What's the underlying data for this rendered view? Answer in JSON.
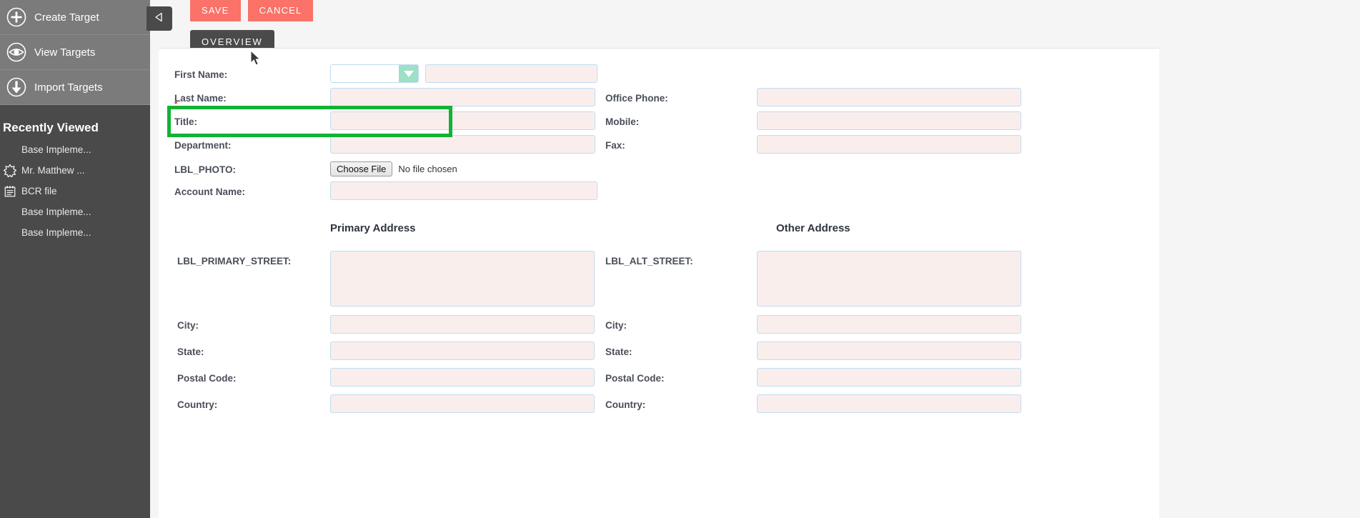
{
  "sidebar": {
    "nav_items": [
      {
        "label": "Create Target",
        "icon": "plus-circle-icon"
      },
      {
        "label": "View Targets",
        "icon": "eye-icon"
      },
      {
        "label": "Import Targets",
        "icon": "download-arrow-icon"
      }
    ],
    "recently_viewed_title": "Recently Viewed",
    "recent_items": [
      {
        "label": "Base Impleme...",
        "icon": "none"
      },
      {
        "label": "Mr. Matthew ...",
        "icon": "star-burst-icon"
      },
      {
        "label": "BCR file",
        "icon": "document-icon"
      },
      {
        "label": "Base Impleme...",
        "icon": "none"
      },
      {
        "label": "Base Impleme...",
        "icon": "none"
      }
    ],
    "collapse_icon": "collapse-left-triangle-icon"
  },
  "actions": {
    "save_label": "SAVE",
    "cancel_label": "CANCEL",
    "button_color": "#fa7268"
  },
  "tabs": [
    {
      "label": "OVERVIEW",
      "active": true
    }
  ],
  "form": {
    "left_column": {
      "first_name_label": "First Name:",
      "salutation_value": "",
      "first_name_value": "",
      "last_name_label": "Last Name:",
      "last_name_value": "",
      "last_name_required": true,
      "title_label": "Title:",
      "title_value": "",
      "department_label": "Department:",
      "department_value": "",
      "photo_label": "LBL_PHOTO:",
      "choose_file_label": "Choose File",
      "no_file_text": "No file chosen",
      "account_name_label": "Account Name:",
      "account_name_value": ""
    },
    "right_column": {
      "office_phone_label": "Office Phone:",
      "office_phone_value": "",
      "mobile_label": "Mobile:",
      "mobile_value": "",
      "fax_label": "Fax:",
      "fax_value": ""
    },
    "primary_address": {
      "section_title": "Primary Address",
      "street_label": "LBL_PRIMARY_STREET:",
      "street_value": "",
      "city_label": "City:",
      "city_value": "",
      "state_label": "State:",
      "state_value": "",
      "postal_code_label": "Postal Code:",
      "postal_code_value": "",
      "country_label": "Country:",
      "country_value": ""
    },
    "other_address": {
      "section_title": "Other Address",
      "street_label": "LBL_ALT_STREET:",
      "street_value": "",
      "city_label": "City:",
      "city_value": "",
      "state_label": "State:",
      "state_value": "",
      "postal_code_label": "Postal Code:",
      "postal_code_value": "",
      "country_label": "Country:",
      "country_value": ""
    }
  },
  "annotation": {
    "highlight_color": "#12b334",
    "highlight_target": "LBL_PHOTO row"
  },
  "colors": {
    "sidebar_dark": "#4a4a4a",
    "sidebar_nav": "#7b7b7b",
    "input_fill": "#faeeed",
    "input_border": "#bfdcef",
    "dropdown_green": "#9fdfc5",
    "page_bg": "#f5f5f5"
  }
}
